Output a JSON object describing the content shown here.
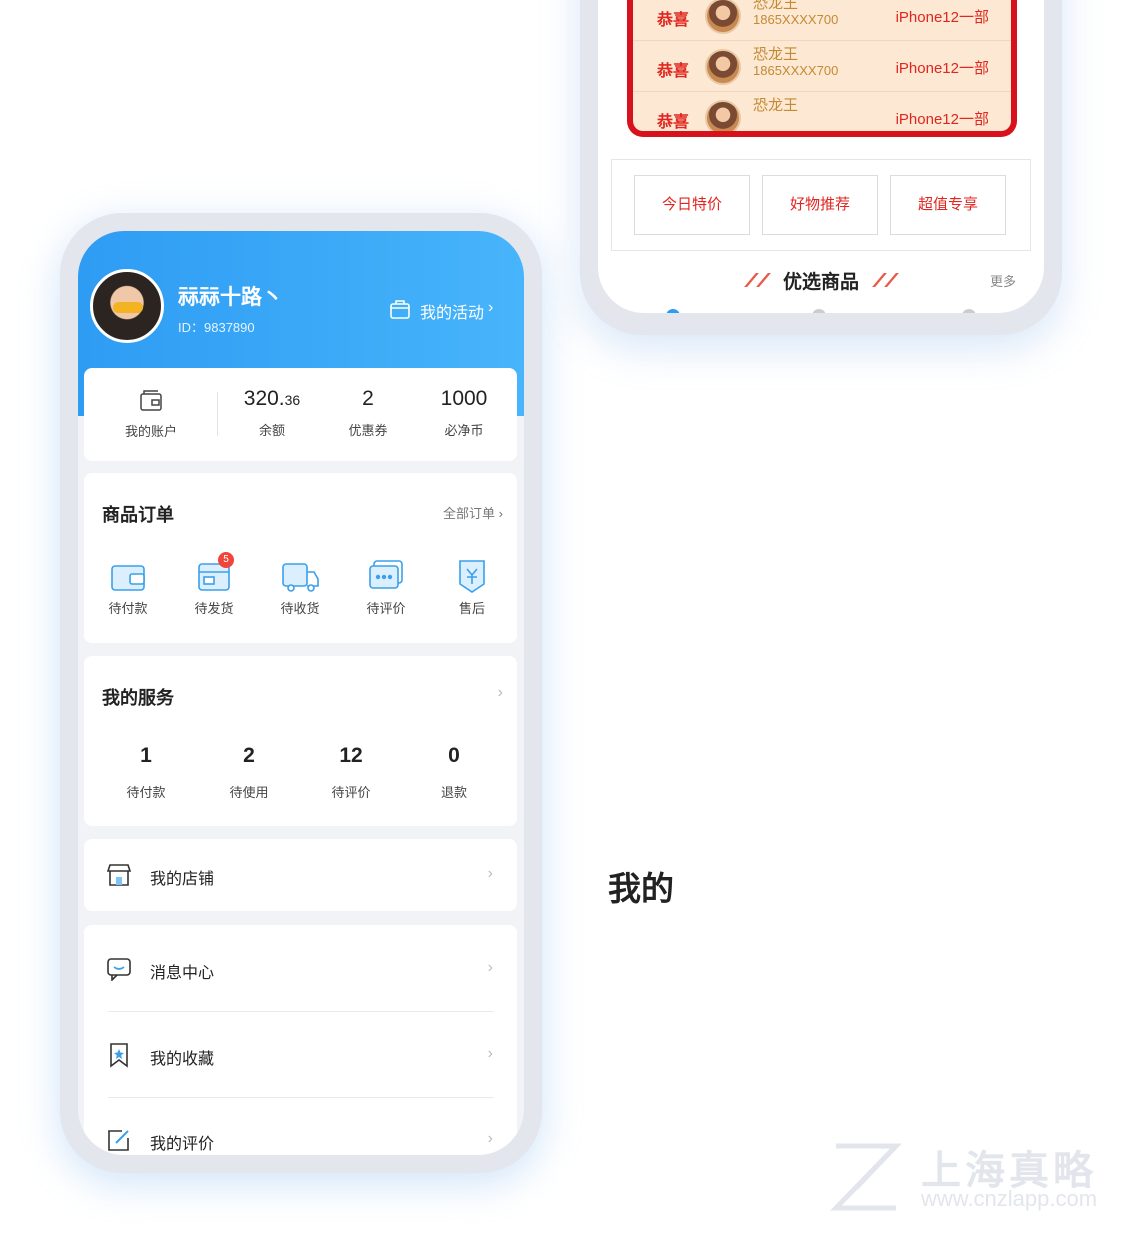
{
  "top_phone": {
    "winners": [
      {
        "prefix": "恭喜",
        "name": "恐龙王",
        "phone": "1865XXXX700",
        "prize": "iPhone12一部"
      },
      {
        "prefix": "恭喜",
        "name": "恐龙王",
        "phone": "1865XXXX700",
        "prize": "iPhone12一部"
      },
      {
        "prefix": "恭喜",
        "name": "恐龙王",
        "phone": "",
        "prize": "iPhone12一部"
      }
    ],
    "quick_buttons": [
      "今日特价",
      "好物推荐",
      "超值专享"
    ],
    "section_title": "优选商品",
    "more": "更多"
  },
  "profile": {
    "name": "祘祘十路丶",
    "id": "ID：9837890",
    "activity": "我的活动"
  },
  "stats": {
    "account_label": "我的账户",
    "balance_int": "320.",
    "balance_dec": "36",
    "balance_label": "余额",
    "coupons": "2",
    "coupons_label": "优惠券",
    "coins": "1000",
    "coins_label": "必净币"
  },
  "orders": {
    "title": "商品订单",
    "all_link": "全部订单",
    "items": [
      {
        "label": "待付款",
        "icon": "wallet-icon"
      },
      {
        "label": "待发货",
        "icon": "package-icon",
        "badge": "5"
      },
      {
        "label": "待收货",
        "icon": "truck-icon"
      },
      {
        "label": "待评价",
        "icon": "comment-icon"
      },
      {
        "label": "售后",
        "icon": "after-sales-icon"
      }
    ]
  },
  "services": {
    "title": "我的服务",
    "items": [
      {
        "num": "1",
        "label": "待付款"
      },
      {
        "num": "2",
        "label": "待使用"
      },
      {
        "num": "12",
        "label": "待评价"
      },
      {
        "num": "0",
        "label": "退款"
      }
    ]
  },
  "menu": {
    "shop": "我的店铺",
    "messages": "消息中心",
    "favorites": "我的收藏",
    "reviews": "我的评价"
  },
  "caption": "我的",
  "watermark": {
    "title": "上海真略",
    "url": "www.cnzlapp.com"
  },
  "colors": {
    "primary": "#2e9cf3",
    "accent_red": "#e0261f",
    "winner_bg": "#fce8d3"
  }
}
